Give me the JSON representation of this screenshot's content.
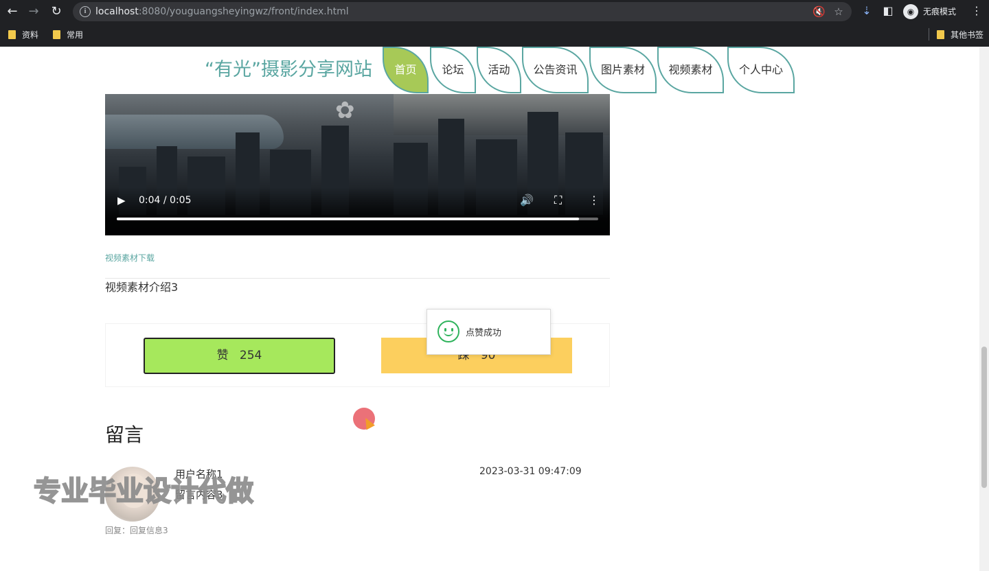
{
  "browser": {
    "url_host": "localhost",
    "url_rest": ":8080/youguangsheyingwz/front/index.html",
    "incognito_label": "无痕模式",
    "bookmarks": [
      "资料",
      "常用"
    ],
    "other_bookmarks": "其他书签"
  },
  "header": {
    "title": "“有光”摄影分享网站",
    "nav": [
      "首页",
      "论坛",
      "活动",
      "公告资讯",
      "图片素材",
      "视频素材",
      "个人中心"
    ],
    "active": "首页"
  },
  "video": {
    "time": "0:04 / 0:05",
    "progress": 0.96
  },
  "content": {
    "download_link": "视频素材下载",
    "intro": "视频素材介绍3",
    "like_label": "赞",
    "like_count": "254",
    "dislike_label": "踩",
    "dislike_count": "90"
  },
  "toast": {
    "message": "点赞成功"
  },
  "comments": {
    "title": "留言",
    "items": [
      {
        "user": "用户名称1",
        "content": "留言内容3",
        "time": "2023-03-31 09:47:09",
        "reply": "回复：回复信息3"
      }
    ]
  },
  "watermark": "专业毕业设计代做",
  "colors": {
    "accent": "#5aa6a1",
    "active_nav": "#a7c957",
    "like": "#a6e85c",
    "dislike": "#fccf5e",
    "toast_icon": "#2fb35c"
  }
}
